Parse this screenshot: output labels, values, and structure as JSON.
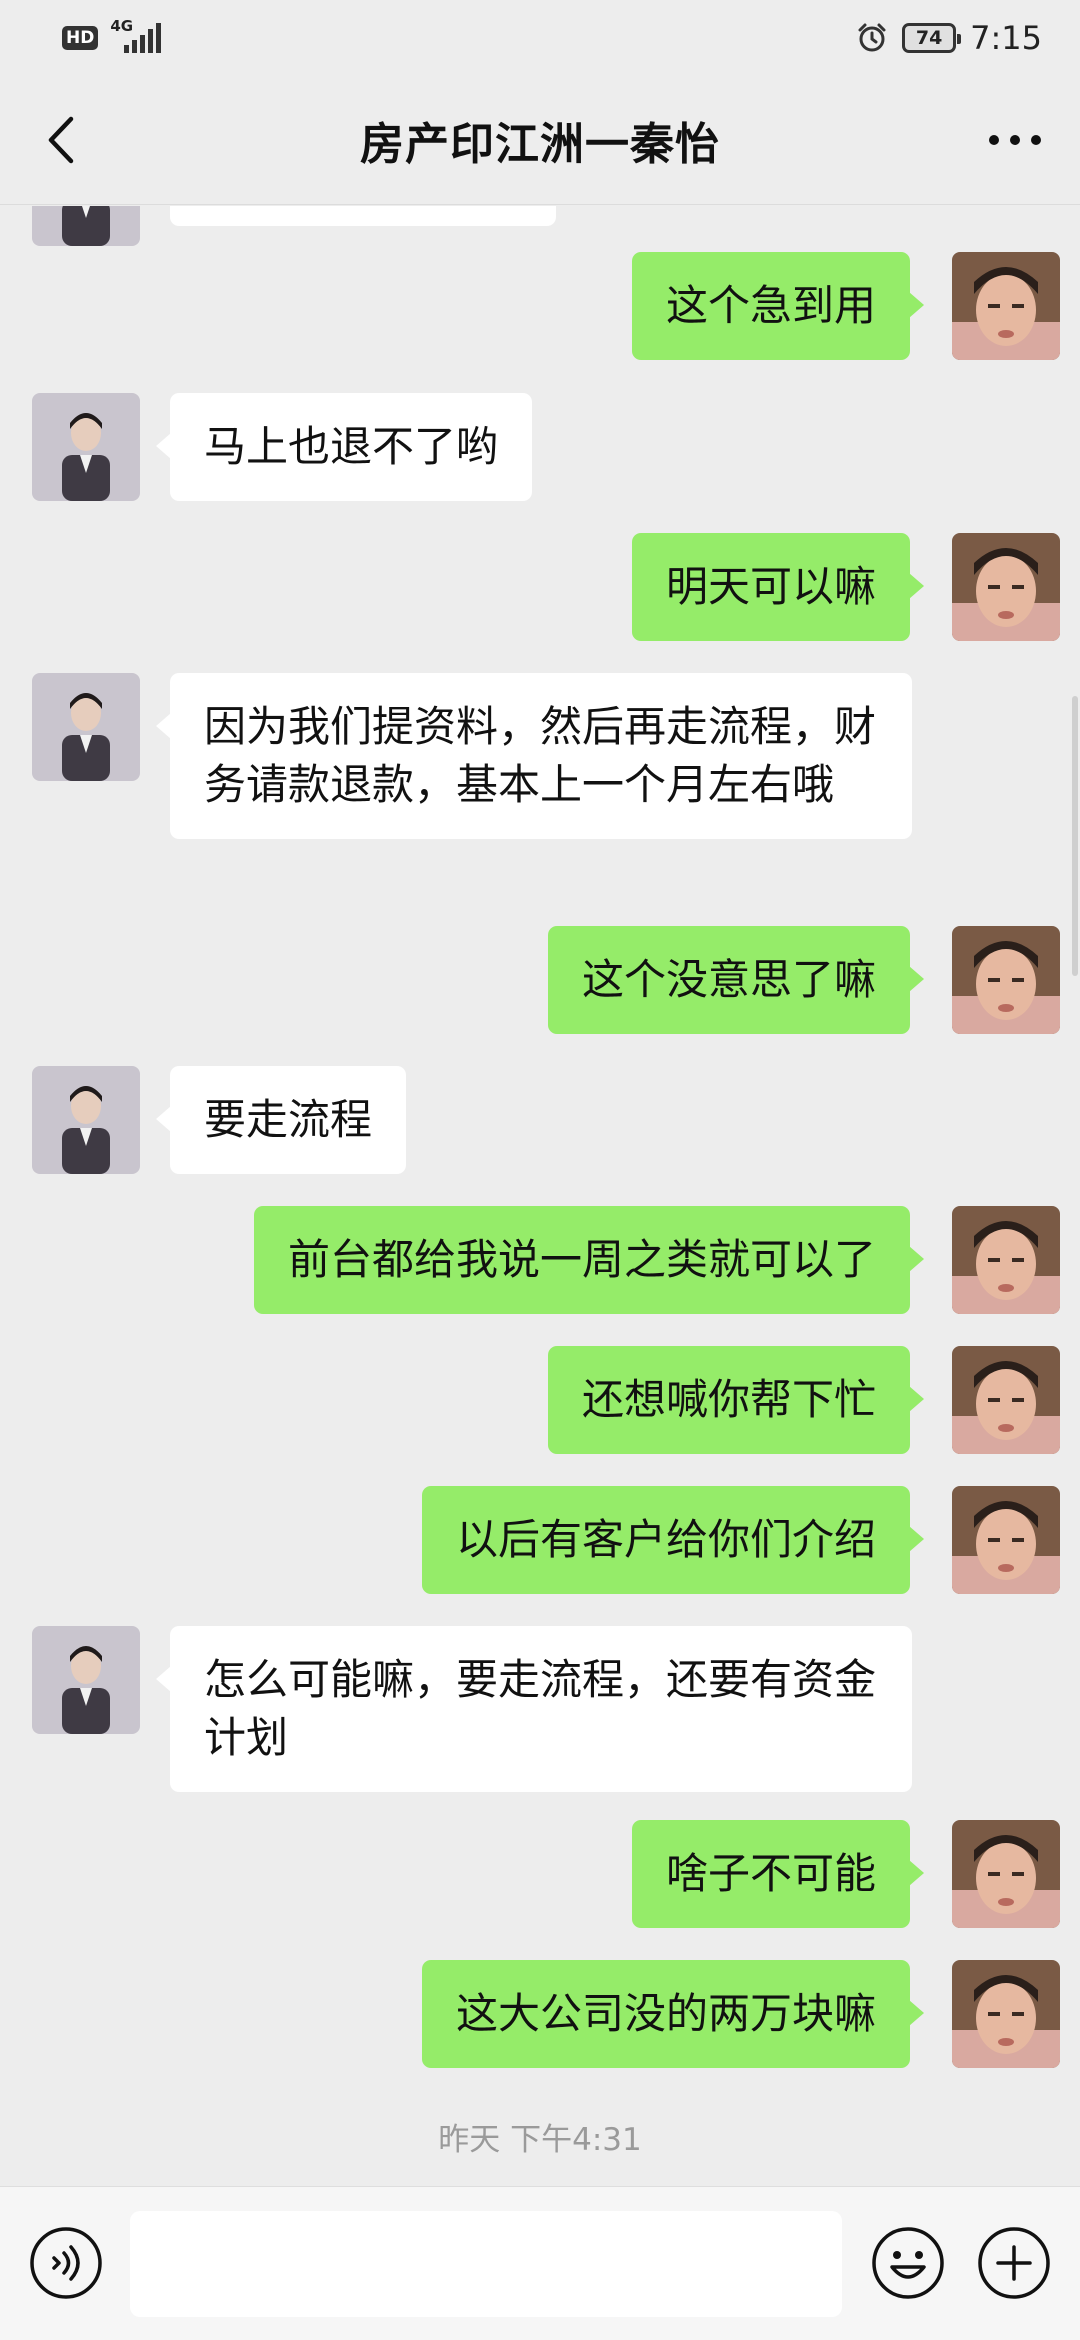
{
  "status_bar": {
    "hd": "HD",
    "network": "4G",
    "battery": "74",
    "time": "7:15"
  },
  "header": {
    "title": "房产印江洲一秦怡",
    "back_icon": "chevron-left-icon",
    "more_icon": "more-horizontal-icon"
  },
  "colors": {
    "background": "#ededed",
    "bubble_outgoing": "#95ec69",
    "bubble_incoming": "#ffffff",
    "timestamp": "#9a9a9a"
  },
  "messages": [
    {
      "side": "in",
      "text": ""
    },
    {
      "side": "out",
      "text": "这个急到用"
    },
    {
      "side": "in",
      "text": "马上也退不了哟"
    },
    {
      "side": "out",
      "text": "明天可以嘛"
    },
    {
      "side": "in",
      "text": "因为我们提资料，然后再走流程，财务请款退款，基本上一个月左右哦"
    },
    {
      "side": "out",
      "text": "这个没意思了嘛"
    },
    {
      "side": "in",
      "text": "要走流程"
    },
    {
      "side": "out",
      "text": "前台都给我说一周之类就可以了"
    },
    {
      "side": "out",
      "text": "还想喊你帮下忙"
    },
    {
      "side": "out",
      "text": "以后有客户给你们介绍"
    },
    {
      "side": "in",
      "text": "怎么可能嘛，要走流程，还要有资金计划"
    },
    {
      "side": "out",
      "text": "啥子不可能"
    },
    {
      "side": "out",
      "text": "这大公司没的两万块嘛"
    }
  ],
  "timestamp": "昨天 下午4:31",
  "input_bar": {
    "voice_icon": "voice-icon",
    "message_value": "",
    "emoji_icon": "emoji-icon",
    "plus_icon": "plus-icon"
  }
}
